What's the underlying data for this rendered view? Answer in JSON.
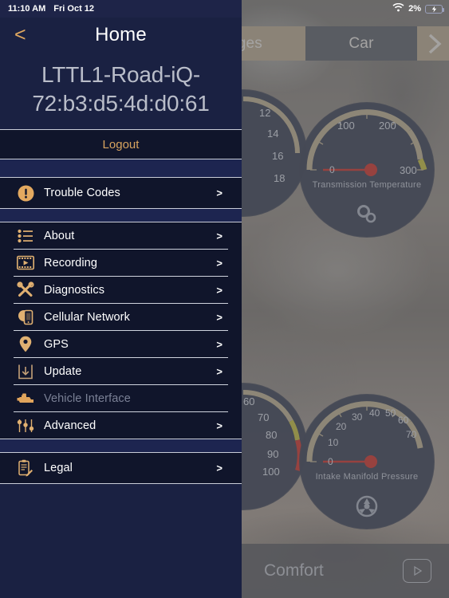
{
  "status_bar": {
    "time": "11:10 AM",
    "date": "Fri Oct 12",
    "wifi_icon": "wifi-icon",
    "battery_percent": "2%",
    "battery_icon": "battery-charging-icon"
  },
  "panel": {
    "back_icon": "back-chevron-icon",
    "title": "Home",
    "device_name": "LTTL1-Road-iQ-72:b3:d5:4d:d0:61",
    "logout_label": "Logout",
    "chevron": ">",
    "alert_group": [
      {
        "label": "Trouble Codes",
        "icon": "alert-circle-icon",
        "chevron": ">",
        "disabled": false
      }
    ],
    "main_group": [
      {
        "label": "About",
        "icon": "list-icon",
        "chevron": ">",
        "disabled": false
      },
      {
        "label": "Recording",
        "icon": "film-play-icon",
        "chevron": ">",
        "disabled": false
      },
      {
        "label": "Diagnostics",
        "icon": "wrench-screwdriver-icon",
        "chevron": ">",
        "disabled": false
      },
      {
        "label": "Cellular Network",
        "icon": "globe-phone-icon",
        "chevron": ">",
        "disabled": false
      },
      {
        "label": "GPS",
        "icon": "map-pin-icon",
        "chevron": ">",
        "disabled": false
      },
      {
        "label": "Update",
        "icon": "download-tray-icon",
        "chevron": ">",
        "disabled": false
      },
      {
        "label": "Vehicle Interface",
        "icon": "engine-icon",
        "chevron": "",
        "disabled": true
      },
      {
        "label": "Advanced",
        "icon": "sliders-icon",
        "chevron": ">",
        "disabled": false
      }
    ],
    "legal_group": [
      {
        "label": "Legal",
        "icon": "clipboard-pencil-icon",
        "chevron": ">",
        "disabled": false
      }
    ]
  },
  "background_app": {
    "tabs": [
      {
        "label": "uges",
        "active": true
      },
      {
        "label": "Car",
        "active": false
      }
    ],
    "next_icon": "chevron-right-icon",
    "gauges": [
      {
        "name": "Transmission Temperature",
        "icon": "gears-icon",
        "ticks": [
          "0",
          "100",
          "200",
          "300"
        ],
        "min": 0,
        "max": 300,
        "value": 0,
        "unit": ""
      },
      {
        "name": "Intake Manifold Pressure",
        "icon": "turbo-fan-icon",
        "ticks": [
          "0",
          "10",
          "20",
          "30",
          "40",
          "50",
          "60",
          "70"
        ],
        "min": 0,
        "max": 70,
        "value": 0,
        "unit": ""
      }
    ],
    "partial_gauges": [
      {
        "ticks": [
          "12",
          "14",
          "16",
          "18"
        ]
      },
      {
        "ticks": [
          "60",
          "70",
          "80",
          "90",
          "100"
        ]
      }
    ],
    "bottom_bar": {
      "label": "Comfort",
      "play_icon": "play-icon"
    }
  },
  "colors": {
    "panel_bg": "#1a2142",
    "row_bg": "#10152b",
    "accent": "#d8a45f",
    "text": "#ffffff",
    "muted": "#7a8095",
    "needle": "#d9453c"
  }
}
